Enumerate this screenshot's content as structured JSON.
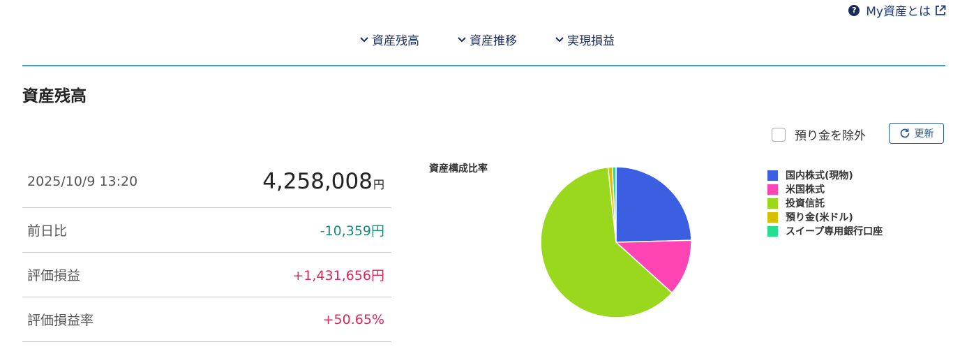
{
  "header": {
    "help_link": "My資産とは",
    "anchors": [
      {
        "label": "資産残高"
      },
      {
        "label": "資産推移"
      },
      {
        "label": "実現損益"
      }
    ]
  },
  "section": {
    "title": "資産残高",
    "exclude_deposit_label": "預り金を除外",
    "exclude_deposit_checked": false,
    "refresh_label": "更新"
  },
  "summary": {
    "datetime": "2025/10/9 13:20",
    "total_value": "4,258,008",
    "total_unit": "円",
    "rows": [
      {
        "label": "前日比",
        "value": "-10,359円",
        "color": "#1a8a7a"
      },
      {
        "label": "評価損益",
        "value": "+1,431,656円",
        "color": "#e0245e"
      },
      {
        "label": "評価損益率",
        "value": "+50.65%",
        "color": "#e0245e"
      }
    ]
  },
  "chart_data": {
    "type": "pie",
    "title": "資産構成比率",
    "legend_position": "right",
    "categories": [
      "国内株式(現物)",
      "米国株式",
      "投資信託",
      "預り金(米ドル)",
      "スイープ専用銀行口座"
    ],
    "values": [
      24.6,
      12.1,
      61.6,
      0.9,
      0.8
    ],
    "colors": [
      "#3b5fe0",
      "#ff45b4",
      "#9ad81e",
      "#d8bf00",
      "#24e08e"
    ]
  }
}
